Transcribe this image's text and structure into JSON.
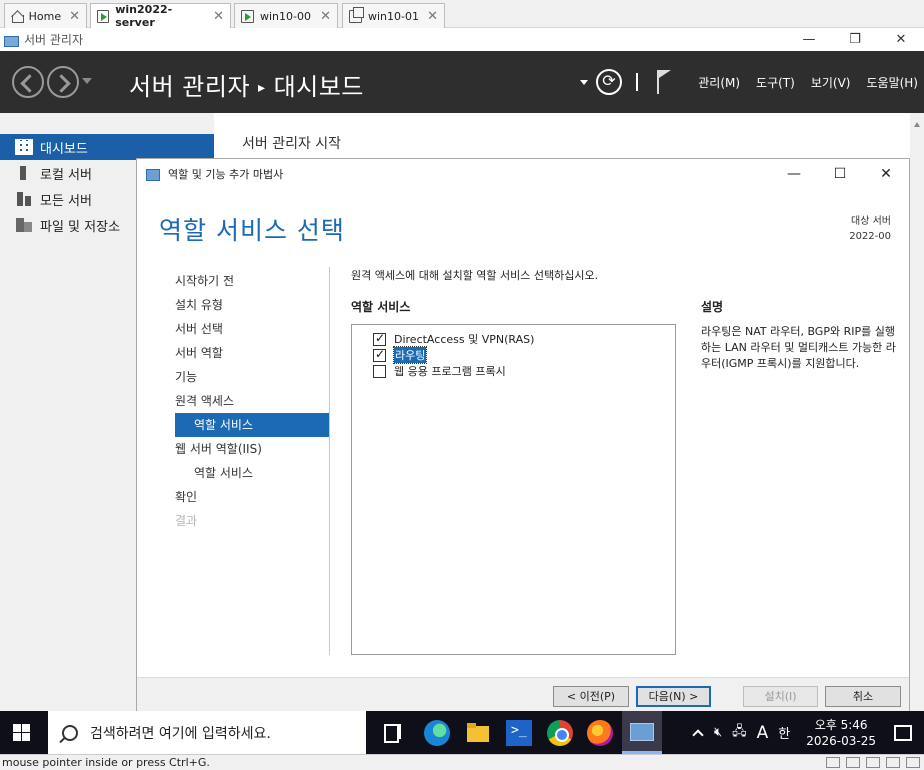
{
  "tabs": [
    {
      "label": "Home"
    },
    {
      "label": "win2022-server"
    },
    {
      "label": "win10-00"
    },
    {
      "label": "win10-01"
    }
  ],
  "server_manager": {
    "window_title": "서버 관리자",
    "breadcrumb_app": "서버 관리자",
    "breadcrumb_page": "대시보드",
    "menu": {
      "manage": "관리(M)",
      "tools": "도구(T)",
      "view": "보기(V)",
      "help": "도움말(H)"
    },
    "nav": [
      {
        "label": "대시보드"
      },
      {
        "label": "로컬 서버"
      },
      {
        "label": "모든 서버"
      },
      {
        "label": "파일 및 저장소"
      }
    ],
    "content_heading": "서버 관리자 시작"
  },
  "wizard": {
    "title": "역할 및 기능 추가 마법사",
    "heading": "역할 서비스 선택",
    "target_label": "대상 서버",
    "target_value": "2022-00",
    "steps": [
      {
        "label": "시작하기 전"
      },
      {
        "label": "설치 유형"
      },
      {
        "label": "서버 선택"
      },
      {
        "label": "서버 역할"
      },
      {
        "label": "기능"
      },
      {
        "label": "원격 액세스"
      },
      {
        "label": "역할 서비스"
      },
      {
        "label": "웹 서버 역할(IIS)"
      },
      {
        "label": "역할 서비스"
      },
      {
        "label": "확인"
      },
      {
        "label": "결과"
      }
    ],
    "instruction": "원격 액세스에 대해 설치할 역할 서비스 선택하십시오.",
    "services_label": "역할 서비스",
    "services": [
      {
        "label": "DirectAccess 및 VPN(RAS)",
        "checked": true
      },
      {
        "label": "라우팅",
        "checked": true
      },
      {
        "label": "웹 응용 프로그램 프록시",
        "checked": false
      }
    ],
    "description_label": "설명",
    "description": "라우팅은 NAT 라우터, BGP와 RIP를 실행하는 LAN 라우터 및 멀티캐스트 가능한 라우터(IGMP 프록시)를 지원합니다.",
    "buttons": {
      "prev": "< 이전(P)",
      "next": "다음(N) >",
      "install": "설치(I)",
      "cancel": "취소"
    }
  },
  "taskbar": {
    "search_placeholder": "검색하려면 여기에 입력하세요.",
    "ime": "A",
    "ime2": "한",
    "time": "오후 5:46",
    "date": "2026-03-25"
  },
  "status_text": "mouse pointer inside or press Ctrl+G."
}
